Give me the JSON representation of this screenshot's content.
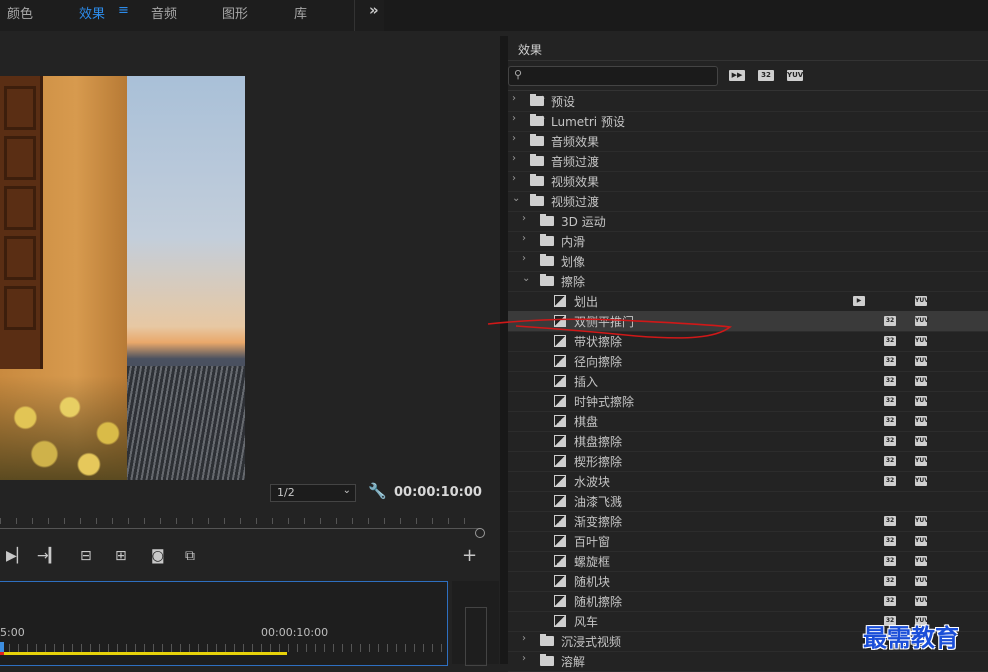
{
  "workspace": {
    "tabs": [
      {
        "label": "颜色",
        "active": false
      },
      {
        "label": "效果",
        "active": true
      },
      {
        "label": "音频",
        "active": false
      },
      {
        "label": "图形",
        "active": false
      },
      {
        "label": "库",
        "active": false
      }
    ],
    "more_label": "»"
  },
  "monitor": {
    "scale": "1/2",
    "timecode": "00:00:10:00"
  },
  "timeline": {
    "tc_left": "5:00",
    "tc_right": "00:00:10:00"
  },
  "effects": {
    "title": "效果",
    "search_placeholder": "",
    "header_badges": [
      "32",
      "YUV"
    ],
    "tree": [
      {
        "label": "预设",
        "level": 0,
        "kind": "preset",
        "expanded": false
      },
      {
        "label": "Lumetri 预设",
        "level": 0,
        "kind": "preset",
        "expanded": false
      },
      {
        "label": "音频效果",
        "level": 0,
        "kind": "folder",
        "expanded": false
      },
      {
        "label": "音频过渡",
        "level": 0,
        "kind": "folder",
        "expanded": false
      },
      {
        "label": "视频效果",
        "level": 0,
        "kind": "folder",
        "expanded": false
      },
      {
        "label": "视频过渡",
        "level": 0,
        "kind": "folder",
        "expanded": true
      },
      {
        "label": "3D 运动",
        "level": 1,
        "kind": "folder",
        "expanded": false
      },
      {
        "label": "内滑",
        "level": 1,
        "kind": "folder",
        "expanded": false
      },
      {
        "label": "划像",
        "level": 1,
        "kind": "folder",
        "expanded": false
      },
      {
        "label": "擦除",
        "level": 1,
        "kind": "folder",
        "expanded": true
      },
      {
        "label": "划出",
        "level": 2,
        "kind": "effect",
        "accel": true,
        "b32": false,
        "yuv": true
      },
      {
        "label": "双侧平推门",
        "level": 2,
        "kind": "effect",
        "accel": false,
        "b32": true,
        "yuv": true,
        "highlighted": true
      },
      {
        "label": "带状擦除",
        "level": 2,
        "kind": "effect",
        "accel": false,
        "b32": true,
        "yuv": true
      },
      {
        "label": "径向擦除",
        "level": 2,
        "kind": "effect",
        "accel": false,
        "b32": true,
        "yuv": true
      },
      {
        "label": "插入",
        "level": 2,
        "kind": "effect",
        "accel": false,
        "b32": true,
        "yuv": true
      },
      {
        "label": "时钟式擦除",
        "level": 2,
        "kind": "effect",
        "accel": false,
        "b32": true,
        "yuv": true
      },
      {
        "label": "棋盘",
        "level": 2,
        "kind": "effect",
        "accel": false,
        "b32": true,
        "yuv": true
      },
      {
        "label": "棋盘擦除",
        "level": 2,
        "kind": "effect",
        "accel": false,
        "b32": true,
        "yuv": true
      },
      {
        "label": "楔形擦除",
        "level": 2,
        "kind": "effect",
        "accel": false,
        "b32": true,
        "yuv": true
      },
      {
        "label": "水波块",
        "level": 2,
        "kind": "effect",
        "accel": false,
        "b32": true,
        "yuv": true
      },
      {
        "label": "油漆飞溅",
        "level": 2,
        "kind": "effect",
        "accel": false,
        "b32": false,
        "yuv": false
      },
      {
        "label": "渐变擦除",
        "level": 2,
        "kind": "effect",
        "accel": false,
        "b32": true,
        "yuv": true
      },
      {
        "label": "百叶窗",
        "level": 2,
        "kind": "effect",
        "accel": false,
        "b32": true,
        "yuv": true
      },
      {
        "label": "螺旋框",
        "level": 2,
        "kind": "effect",
        "accel": false,
        "b32": true,
        "yuv": true
      },
      {
        "label": "随机块",
        "level": 2,
        "kind": "effect",
        "accel": false,
        "b32": true,
        "yuv": true
      },
      {
        "label": "随机擦除",
        "level": 2,
        "kind": "effect",
        "accel": false,
        "b32": true,
        "yuv": true
      },
      {
        "label": "风车",
        "level": 2,
        "kind": "effect",
        "accel": false,
        "b32": true,
        "yuv": true
      },
      {
        "label": "沉浸式视频",
        "level": 1,
        "kind": "folder",
        "expanded": false
      },
      {
        "label": "溶解",
        "level": 1,
        "kind": "folder",
        "expanded": false
      }
    ]
  },
  "watermark": "最需教育"
}
